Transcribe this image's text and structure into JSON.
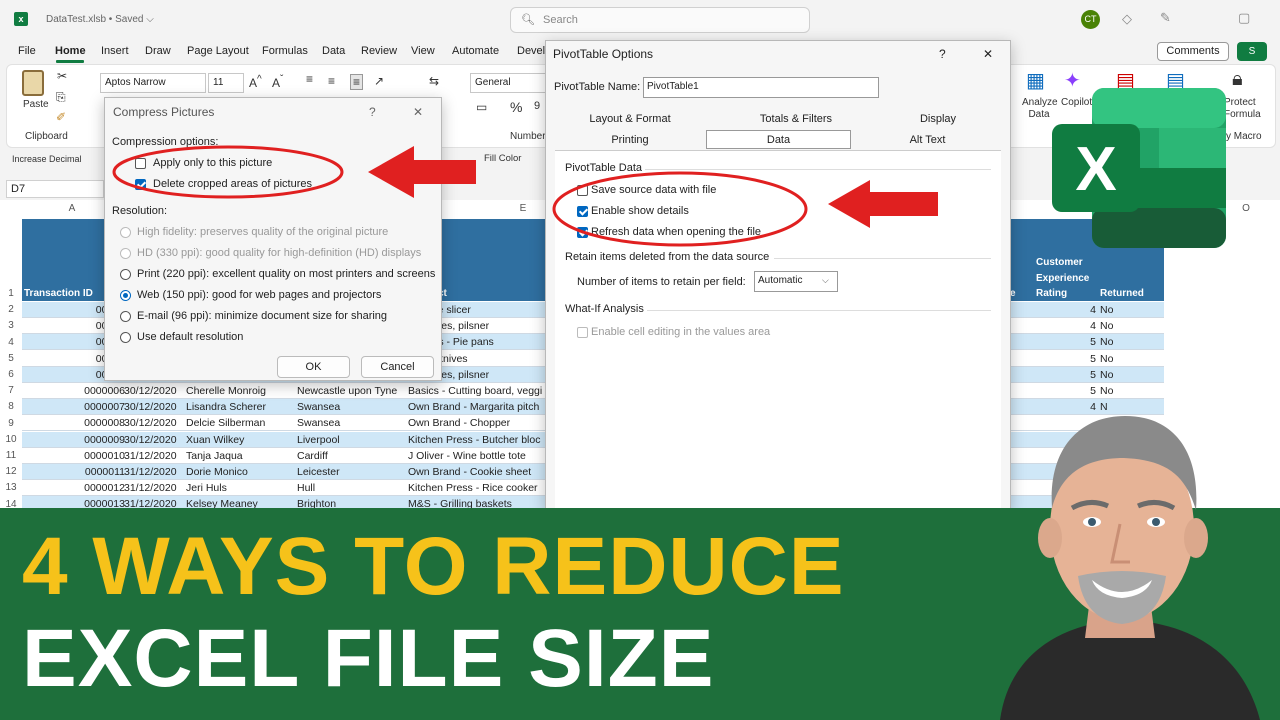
{
  "titlebar": {
    "file_title": "DataTest.xlsb  •  Saved ⌵",
    "search_placeholder": "Search",
    "avatar_initials": "CT"
  },
  "ribbon_tabs": [
    "File",
    "Home",
    "Insert",
    "Draw",
    "Page Layout",
    "Formulas",
    "Data",
    "Review",
    "View",
    "Automate",
    "Devel"
  ],
  "ribbon": {
    "comments_label": "Comments",
    "share_label": "S",
    "paste_label": "Paste",
    "clipboard_label": "Clipboard",
    "font_name": "Aptos Narrow",
    "font_size": "11",
    "number_format": "General",
    "number_label": "Number",
    "analyze_label": "Analyze Data",
    "copilot_label": "Copilot",
    "protect_label": "Protect Formula",
    "macros_label": "y Macro",
    "increase_decimal": "Increase Decimal",
    "fill_color": "Fill Color"
  },
  "namebox": "D7",
  "grid": {
    "col_headers": [
      "A",
      "E",
      "O"
    ],
    "header_labels": {
      "transaction_id": "Transaction ID",
      "product": "ct",
      "customer_experience": "Customer Experience",
      "rating": "Rating",
      "returned": "Returned",
      "e_frag": "e"
    },
    "row_numbers": [
      "1",
      "2",
      "3",
      "4",
      "5",
      "6",
      "7",
      "8",
      "9",
      "10",
      "11",
      "12",
      "13",
      "14"
    ],
    "rows": [
      {
        "id": "00000",
        "date": "",
        "name": "",
        "city": "",
        "product": "- Truffle slicer",
        "rating": "4",
        "returned": "No"
      },
      {
        "id": "00000",
        "date": "",
        "name": "",
        "city": "",
        "product": "- Glasses, pilsner",
        "rating": "4",
        "returned": "No"
      },
      {
        "id": "00000",
        "date": "",
        "name": "",
        "city": "",
        "product": "n Press - Pie pans",
        "rating": "5",
        "returned": "No"
      },
      {
        "id": "00000",
        "date": "",
        "name": "",
        "city": "",
        "product": "Steak knives",
        "rating": "5",
        "returned": "No"
      },
      {
        "id": "00000",
        "date": "",
        "name": "",
        "city": "",
        "product": "- Glasses, pilsner",
        "rating": "5",
        "returned": "No"
      },
      {
        "id": "0000006",
        "date": "30/12/2020",
        "name": "Cherelle Monroig",
        "city": "Newcastle upon Tyne",
        "product": "Basics - Cutting board, veggi",
        "rating": "5",
        "returned": "No"
      },
      {
        "id": "0000007",
        "date": "30/12/2020",
        "name": "Lisandra Scherer",
        "city": "Swansea",
        "product": "Own Brand - Margarita pitch",
        "rating": "4",
        "returned": "N"
      },
      {
        "id": "0000008",
        "date": "30/12/2020",
        "name": "Delcie Silberman",
        "city": "Swansea",
        "product": "Own Brand - Chopper",
        "rating": "",
        "returned": ""
      },
      {
        "id": "0000009",
        "date": "30/12/2020",
        "name": "Xuan Wilkey",
        "city": "Liverpool",
        "product": "Kitchen Press - Butcher bloc",
        "rating": "",
        "returned": ""
      },
      {
        "id": "0000010",
        "date": "31/12/2020",
        "name": "Tanja Jaqua",
        "city": "Cardiff",
        "product": "J Oliver - Wine bottle tote",
        "rating": "",
        "returned": ""
      },
      {
        "id": "0000011",
        "date": "31/12/2020",
        "name": "Dorie Monico",
        "city": "Leicester",
        "product": "Own Brand - Cookie sheet",
        "rating": "",
        "returned": ""
      },
      {
        "id": "0000012",
        "date": "31/12/2020",
        "name": "Jeri Huls",
        "city": "Hull",
        "product": "Kitchen Press - Rice cooker",
        "rating": "",
        "returned": ""
      },
      {
        "id": "0000013",
        "date": "31/12/2020",
        "name": "Kelsey Meaney",
        "city": "Brighton",
        "product": "M&S - Grilling baskets",
        "rating": "",
        "returned": ""
      }
    ]
  },
  "compress_dialog": {
    "title": "Compress Pictures",
    "help": "?",
    "close": "✕",
    "compression_options_label": "Compression options:",
    "apply_only_label": "Apply only to this picture",
    "apply_only_checked": false,
    "delete_cropped_label": "Delete cropped areas of pictures",
    "delete_cropped_checked": true,
    "resolution_label": "Resolution:",
    "resolutions": [
      {
        "label": "High fidelity: preserves quality of the original picture",
        "enabled": false,
        "selected": false
      },
      {
        "label": "HD (330 ppi): good quality for high-definition (HD) displays",
        "enabled": false,
        "selected": false
      },
      {
        "label": "Print (220 ppi): excellent quality on most printers and screens",
        "enabled": true,
        "selected": false
      },
      {
        "label": "Web (150 ppi): good for web pages and projectors",
        "enabled": true,
        "selected": true
      },
      {
        "label": "E-mail (96 ppi): minimize document size for sharing",
        "enabled": true,
        "selected": false
      },
      {
        "label": "Use default resolution",
        "enabled": true,
        "selected": false
      }
    ],
    "ok_label": "OK",
    "cancel_label": "Cancel"
  },
  "pivot_dialog": {
    "title": "PivotTable Options",
    "help": "?",
    "close": "✕",
    "name_label": "PivotTable Name:",
    "name_value": "PivotTable1",
    "tabs_row1": [
      "Layout & Format",
      "Totals & Filters",
      "Display"
    ],
    "tabs_row2": [
      "Printing",
      "Data",
      "Alt Text"
    ],
    "active_tab": "Data",
    "section_pivot_data": "PivotTable Data",
    "save_source_label": "Save source data with file",
    "save_source_checked": false,
    "enable_details_label": "Enable show details",
    "enable_details_checked": true,
    "refresh_label": "Refresh data when opening the file",
    "refresh_checked": true,
    "section_retain": "Retain items deleted from the data source",
    "number_items_label": "Number of items to retain per field:",
    "number_items_value": "Automatic",
    "section_whatif": "What-If Analysis",
    "cell_editing_label": "Enable cell editing in the values area",
    "cell_editing_checked": false
  },
  "colors": {
    "excel_green": "#107c41",
    "banner_green": "#1e6f3b",
    "banner_yellow": "#f6c21a",
    "annotation_red": "#e02020",
    "header_blue": "#2f6fa0",
    "row_alt": "#cfe7f7"
  },
  "banner": {
    "line1": "4 WAYS TO REDUCE",
    "line2": "EXCEL FILE SIZE"
  },
  "logo": {
    "letter": "X"
  }
}
